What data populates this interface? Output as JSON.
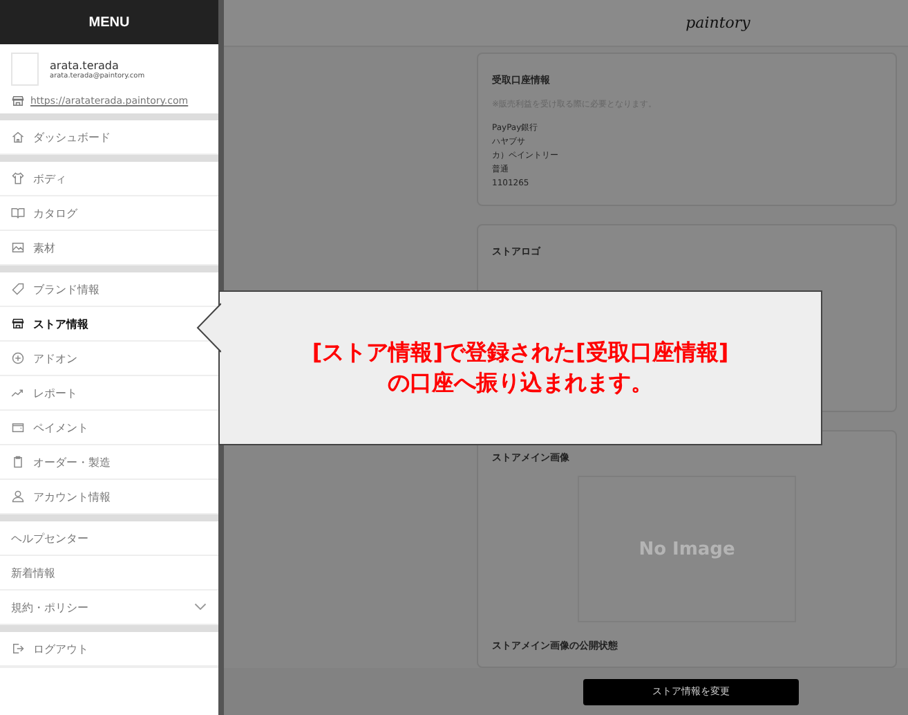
{
  "menu": {
    "title": "MENU"
  },
  "profile": {
    "name": "arata.terada",
    "email": "arata.terada@paintory.com",
    "url": "https://arataterada.paintory.com"
  },
  "nav_groups": [
    [
      {
        "label": "ダッシュボード",
        "selected": false
      }
    ],
    [
      {
        "label": "ボディ",
        "selected": false
      },
      {
        "label": "カタログ",
        "selected": false
      },
      {
        "label": "素材",
        "selected": false
      }
    ],
    [
      {
        "label": "ブランド情報",
        "selected": false
      },
      {
        "label": "ストア情報",
        "selected": true
      },
      {
        "label": "アドオン",
        "selected": false
      },
      {
        "label": "レポート",
        "selected": false
      },
      {
        "label": "ペイメント",
        "selected": false
      },
      {
        "label": "オーダー・製造",
        "selected": false
      },
      {
        "label": "アカウント情報",
        "selected": false
      }
    ],
    [
      {
        "label": "ヘルプセンター",
        "selected": false
      },
      {
        "label": "新着情報",
        "selected": false
      },
      {
        "label": "規約・ポリシー",
        "selected": false,
        "expanded": false
      }
    ],
    [
      {
        "label": "ログアウト",
        "selected": false
      }
    ]
  ],
  "header": {
    "logo": "paintory"
  },
  "bank_card": {
    "title": "受取口座情報",
    "note": "※販売利益を受け取る際に必要となります。",
    "lines": [
      "PayPay銀行",
      "ハヤブサ",
      "カ）ペイントリー",
      "普通",
      "1101265"
    ]
  },
  "logo_card": {
    "title": "ストアロゴ"
  },
  "main_image_card": {
    "title": "ストアメイン画像",
    "image_placeholder": "No Image",
    "status_title": "ストアメイン画像の公開状態"
  },
  "save_button": "ストア情報を変更",
  "callout": {
    "lines": [
      "[ストア情報]で登録された[受取口座情報]",
      "の口座へ振り込まれます。"
    ]
  }
}
